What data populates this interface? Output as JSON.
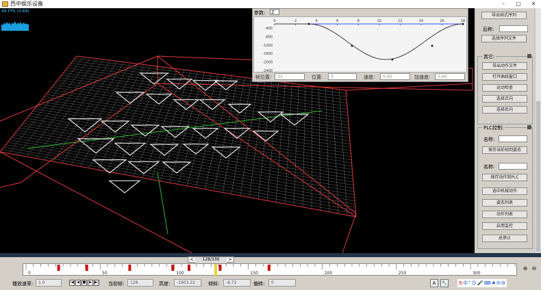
{
  "window": {
    "title": "西中娱乐设备",
    "fps_text": "49 FPS (3-69)"
  },
  "curve_panel": {
    "param_label": "参数:",
    "param_select": "Z",
    "x_ticks": [
      "0",
      "2",
      "4",
      "6",
      "8",
      "10",
      "12",
      "14",
      "16",
      "18"
    ],
    "y_ticks": [
      "-400",
      "-600",
      "-1200",
      "-1600",
      "-2000",
      "-2400"
    ],
    "fields": {
      "frame_pos_label": "帧位置:",
      "frame_pos_value": "31",
      "position_label": "位置:",
      "position_value": "0",
      "speed_label": "速度:",
      "speed_value": "0.00",
      "accel_label": "加速度:",
      "accel_value": "0.00"
    },
    "colors": {
      "curve": "#3a3a3a",
      "axis": "#3355ff"
    }
  },
  "right_panel": {
    "export_sequence": "导出帧式序列",
    "suffix_label": "后称:",
    "select_sequence_file": "选择序列文件",
    "other_title": "其它:",
    "other_buttons": [
      "导出动作文件",
      "打开曲线窗口",
      "运动检查",
      "选择正向",
      "选择反向"
    ],
    "plc_title": "PLC控制:",
    "name_label": "名称:",
    "save_current_frame": "保存当前帧到姿态",
    "name_label2": "名称:",
    "save_action_plc": "保存动作到PLC",
    "plc_buttons": [
      "选中机械动作",
      "姿态列表",
      "动作列表",
      "启用监控",
      "总停止"
    ]
  },
  "timeline": {
    "nav_prev": "<",
    "nav_next": ">",
    "nav_value": "128/330",
    "ruler_labels": [
      "0",
      "50",
      "100",
      "150",
      "200",
      "250",
      "300"
    ],
    "keyframes": [
      22,
      41,
      70,
      99,
      110,
      131,
      164
    ],
    "current_frame": 128,
    "max_frame": 330,
    "zoom_in": "⊕",
    "zoom_out": "⊖"
  },
  "bottom_bar": {
    "play_rate_label": "播放速率:",
    "play_rate_value": "1.0",
    "transport": [
      "|◀",
      "◀",
      "■",
      "▶",
      "▶|"
    ],
    "current_frame_label": "当前帧:",
    "current_frame_value": "128",
    "height_label": "高度:",
    "height_value": "-1903.22",
    "tilt_label": "倾斜:",
    "tilt_value": "-8.72",
    "yaw_label": "偏转:",
    "yaw_value": "0",
    "tool_a": "A",
    "tool_b": "🔧",
    "ime": [
      "S",
      "中",
      "°",
      "☺",
      "🎤",
      "⌨",
      "♠",
      "✉",
      "⚙"
    ]
  }
}
